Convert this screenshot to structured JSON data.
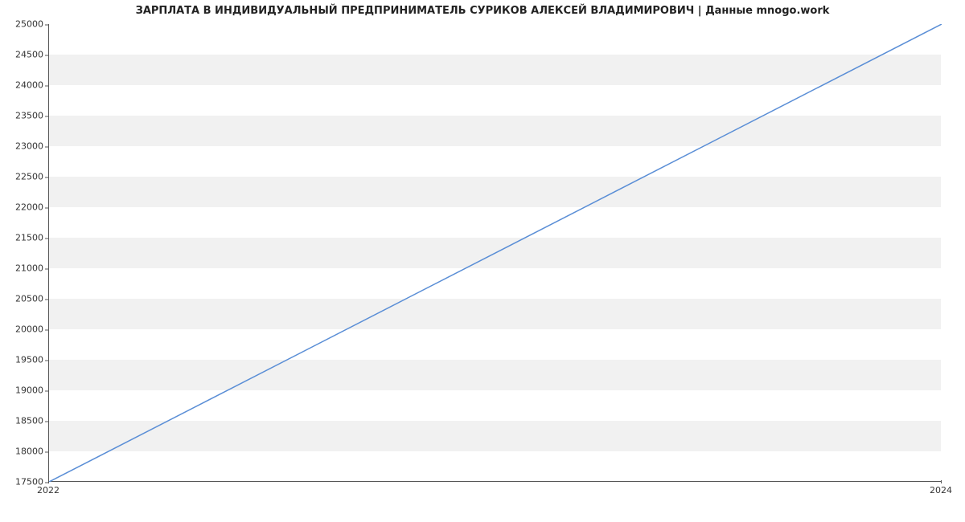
{
  "chart_data": {
    "type": "line",
    "title": "ЗАРПЛАТА В ИНДИВИДУАЛЬНЫЙ ПРЕДПРИНИМАТЕЛЬ СУРИКОВ АЛЕКСЕЙ ВЛАДИМИРОВИЧ | Данные mnogo.work",
    "x": [
      2022,
      2024
    ],
    "y": [
      17500,
      25000
    ],
    "xlabel": "",
    "ylabel": "",
    "xlim": [
      2022,
      2024
    ],
    "ylim": [
      17500,
      25000
    ],
    "xticks": [
      2022,
      2024
    ],
    "yticks": [
      17500,
      18000,
      18500,
      19000,
      19500,
      20000,
      20500,
      21000,
      21500,
      22000,
      22500,
      23000,
      23500,
      24000,
      24500,
      25000
    ],
    "line_color": "#5a8ed6",
    "band_color": "#f1f1f1",
    "grid": false
  }
}
